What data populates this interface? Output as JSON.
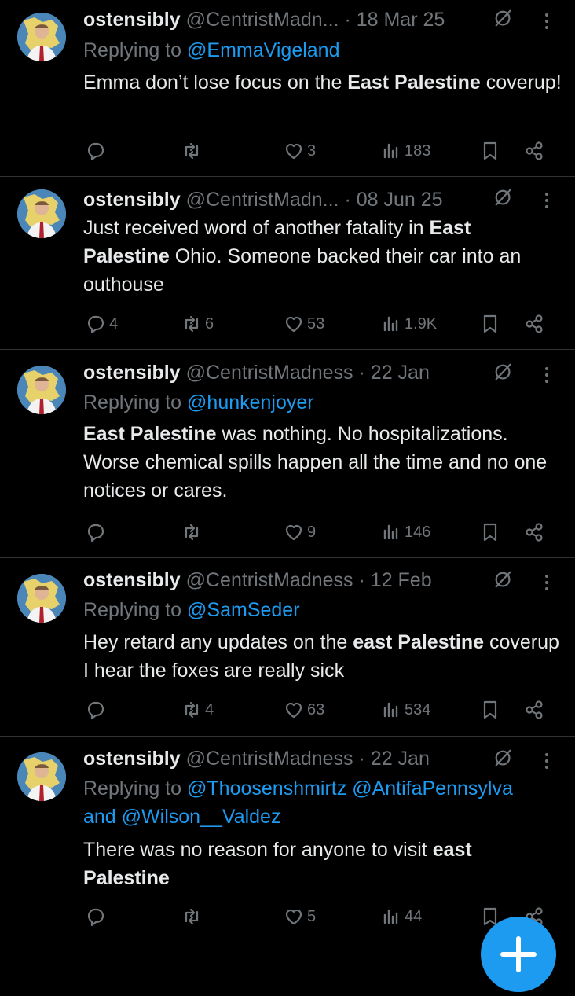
{
  "tweets": [
    {
      "name": "ostensibly",
      "handle": "@CentristMadn...",
      "time": "· 18 Mar 25",
      "replying_prefix": "Replying to ",
      "mentions": "@EmmaVigeland",
      "body": [
        "Emma don’t lose focus on the ",
        {
          "b": "East Palestine"
        },
        " coverup!"
      ],
      "replies": "",
      "reposts": "",
      "likes": "3",
      "views": "183"
    },
    {
      "name": "ostensibly",
      "handle": "@CentristMadn...",
      "time": "· 08 Jun 25",
      "replying_prefix": "",
      "mentions": "",
      "body": [
        "Just received word of another fatality in ",
        {
          "b": "East Palestine"
        },
        " Ohio. Someone backed their car into an outhouse"
      ],
      "replies": "4",
      "reposts": "6",
      "likes": "53",
      "views": "1.9K"
    },
    {
      "name": "ostensibly",
      "handle": "@CentristMadness",
      "time": "· 22 Jan",
      "replying_prefix": "Replying to ",
      "mentions": "@hunkenjoyer",
      "body": [
        {
          "b": "East Palestine"
        },
        " was nothing. No hospitalizations. Worse chemical spills happen all the time and no one notices or cares."
      ],
      "replies": "",
      "reposts": "",
      "likes": "9",
      "views": "146"
    },
    {
      "name": "ostensibly",
      "handle": "@CentristMadness",
      "time": "· 12 Feb",
      "replying_prefix": "Replying to ",
      "mentions": "@SamSeder",
      "body": [
        "Hey retard any updates on the ",
        {
          "b": "east Palestine"
        },
        " coverup I hear the foxes are really sick"
      ],
      "replies": "",
      "reposts": "4",
      "likes": "63",
      "views": "534"
    },
    {
      "name": "ostensibly",
      "handle": "@CentristMadness",
      "time": "· 22 Jan",
      "replying_prefix": "Replying to ",
      "mentions": "@Thoosenshmirtz @AntifaPennsylva",
      "mentions_and": "and ",
      "mentions_2": "@Wilson__Valdez",
      "body": [
        "There was no reason for anyone to visit ",
        {
          "b": "east Palestine"
        }
      ],
      "replies": "",
      "reposts": "",
      "likes": "5",
      "views": "44"
    }
  ],
  "icons": {
    "reply": "reply-icon",
    "repost": "repost-icon",
    "like": "heart-icon",
    "views": "views-icon",
    "bookmark": "bookmark-icon",
    "share": "share-icon",
    "grok": "grok-icon",
    "more": "more-icon",
    "compose": "compose-icon"
  },
  "colors": {
    "background": "#000000",
    "text": "#e7e9ea",
    "muted": "#71767b",
    "accent": "#1d9bf0"
  }
}
